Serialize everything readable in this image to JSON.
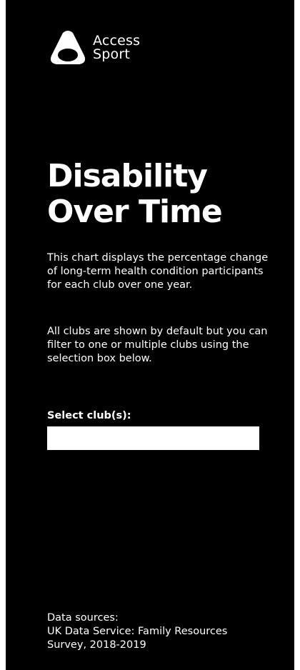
{
  "logo": {
    "icon": "access-sport-logo-mark",
    "line1": "Access",
    "line2": "Sport"
  },
  "title": {
    "line1": "Disability",
    "line2": "Over Time"
  },
  "description": {
    "paragraph1": "This chart displays the percentage change of long-term health condition participants for each club over one year.",
    "paragraph2": "All clubs are shown by default but you can filter to one or multiple clubs using the selection box below."
  },
  "filter": {
    "label": "Select club(s):",
    "value": ""
  },
  "sources": {
    "heading": "Data sources:",
    "line1": "UK Data Service: Family Resources",
    "line2": "Survey, 2018-2019"
  },
  "colors": {
    "background": "#000000",
    "text": "#ffffff",
    "select_box": "#ffffff"
  }
}
